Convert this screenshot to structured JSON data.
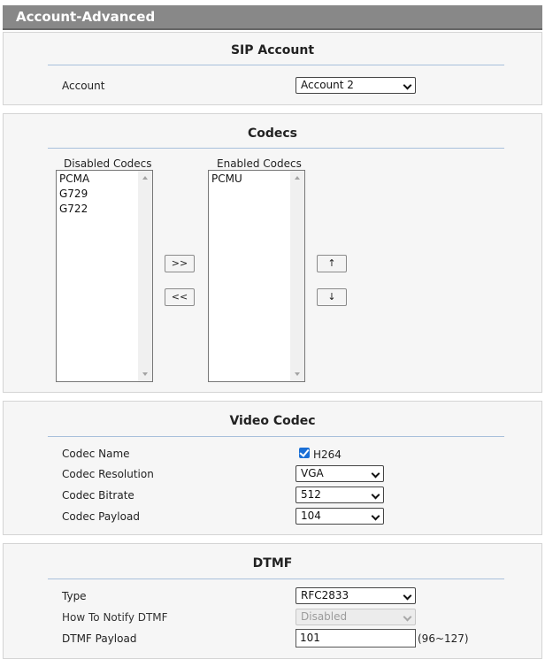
{
  "page": {
    "title": "Account-Advanced"
  },
  "sip": {
    "title": "SIP Account",
    "account_label": "Account",
    "account_value": "Account 2"
  },
  "codecs": {
    "title": "Codecs",
    "disabled_label": "Disabled Codecs",
    "enabled_label": "Enabled Codecs",
    "disabled": [
      "PCMA",
      "G729",
      "G722"
    ],
    "enabled": [
      "PCMU"
    ],
    "buttons": {
      "add": ">>",
      "remove": "<<",
      "up": "↑",
      "down": "↓"
    }
  },
  "video": {
    "title": "Video Codec",
    "name_label": "Codec Name",
    "name_value": "H264",
    "name_checked": true,
    "resolution_label": "Codec Resolution",
    "resolution_value": "VGA",
    "bitrate_label": "Codec Bitrate",
    "bitrate_value": "512",
    "payload_label": "Codec Payload",
    "payload_value": "104"
  },
  "dtmf": {
    "title": "DTMF",
    "type_label": "Type",
    "type_value": "RFC2833",
    "notify_label": "How To Notify DTMF",
    "notify_value": "Disabled",
    "payload_label": "DTMF Payload",
    "payload_value": "101",
    "payload_range": "(96~127)"
  },
  "colors": {
    "title_bar": "#888888",
    "panel_bg": "#f6f6f6",
    "rule": "#a8c0db",
    "checkbox": "#1a6fd6"
  }
}
